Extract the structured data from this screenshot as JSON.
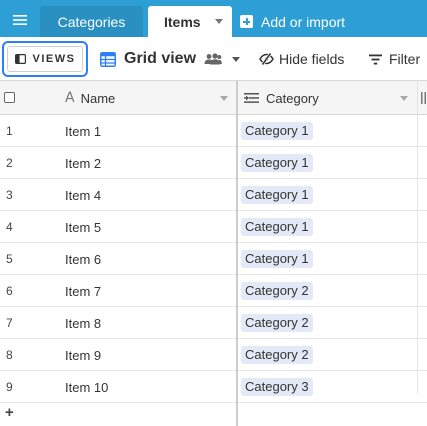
{
  "topbar": {
    "tabs": [
      {
        "label": "Categories",
        "active": false
      },
      {
        "label": "Items",
        "active": true
      }
    ],
    "add_import_label": "Add or import"
  },
  "toolbar": {
    "views_label": "VIEWS",
    "view_name": "Grid view",
    "hide_fields_label": "Hide fields",
    "filter_label": "Filter"
  },
  "grid": {
    "columns": [
      {
        "label": "Name",
        "type_icon": "text-field-icon"
      },
      {
        "label": "Category",
        "type_icon": "link-field-icon"
      }
    ],
    "rows": [
      {
        "num": "1",
        "name": "Item 1",
        "category": "Category 1"
      },
      {
        "num": "2",
        "name": "Item 2",
        "category": "Category 1"
      },
      {
        "num": "3",
        "name": "Item 4",
        "category": "Category 1"
      },
      {
        "num": "4",
        "name": "Item 5",
        "category": "Category 1"
      },
      {
        "num": "5",
        "name": "Item 6",
        "category": "Category 1"
      },
      {
        "num": "6",
        "name": "Item 7",
        "category": "Category 2"
      },
      {
        "num": "7",
        "name": "Item 8",
        "category": "Category 2"
      },
      {
        "num": "8",
        "name": "Item 9",
        "category": "Category 2"
      },
      {
        "num": "9",
        "name": "Item 10",
        "category": "Category 3"
      }
    ],
    "add_row_symbol": "+"
  },
  "colors": {
    "topbar": "#2d9fd4",
    "inactive_tab": "#2a90c1",
    "views_focus": "#2d7ff9",
    "chip": "#e3e9f6"
  }
}
